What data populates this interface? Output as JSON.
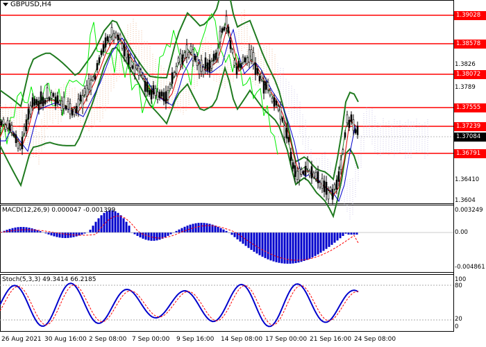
{
  "symbol": {
    "title": "GBPUSD,H4"
  },
  "price_levels": [
    {
      "value": "1.39028",
      "style": "red"
    },
    {
      "value": "1.38578",
      "style": "red"
    },
    {
      "value": "1.38072",
      "style": "red"
    },
    {
      "value": "1.37555",
      "style": "red"
    },
    {
      "value": "1.37239",
      "style": "red"
    },
    {
      "value": "1.36791",
      "style": "red"
    }
  ],
  "current_price": "1.37084",
  "price_axis_ticks": [
    "1.3826",
    "1.3789",
    "1.36410",
    "1.3604"
  ],
  "macd": {
    "label": "MACD(12,26,9) 0.000047 -0.001399",
    "axis": [
      "0.003249",
      "0.00",
      "-0.004861"
    ]
  },
  "stoch": {
    "label": "Stoch(5,3,3) 49.3414 66.2185",
    "axis": [
      "100",
      "80",
      "20",
      "0"
    ]
  },
  "time_axis": [
    "26 Aug 2021",
    "30 Aug 16:00",
    "2 Sep 08:00",
    "7 Sep 00:00",
    "9 Sep 16:00",
    "14 Sep 08:00",
    "17 Sep 00:00",
    "21 Sep 16:00",
    "24 Sep 08:00"
  ],
  "colors": {
    "level_line": "#ff0000",
    "bollinger": "#1f7a1f",
    "envelope": "#00ee00",
    "kijun": "#0000cc",
    "tenkan": "#dd0000",
    "macd_hist": "#0000cc",
    "macd_signal": "#ff0000",
    "stoch_main": "#0000cc",
    "stoch_signal": "#ff0000"
  }
}
